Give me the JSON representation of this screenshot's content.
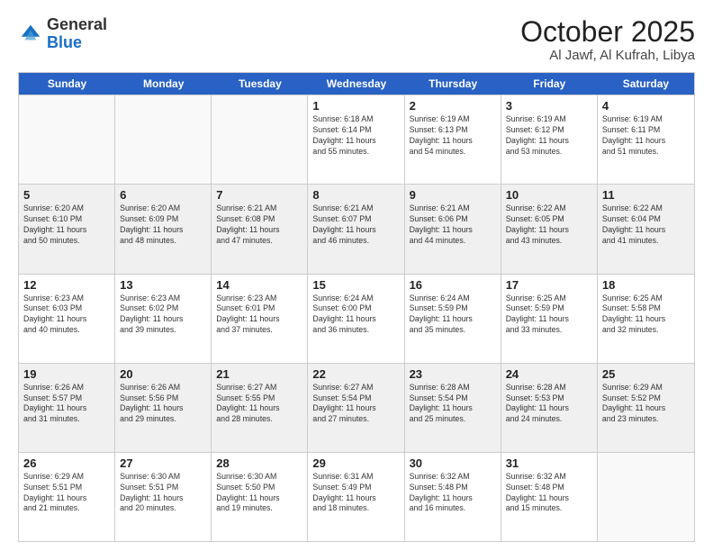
{
  "logo": {
    "general": "General",
    "blue": "Blue"
  },
  "header": {
    "month": "October 2025",
    "location": "Al Jawf, Al Kufrah, Libya"
  },
  "days": [
    "Sunday",
    "Monday",
    "Tuesday",
    "Wednesday",
    "Thursday",
    "Friday",
    "Saturday"
  ],
  "weeks": [
    [
      {
        "day": "",
        "info": "",
        "empty": true
      },
      {
        "day": "",
        "info": "",
        "empty": true
      },
      {
        "day": "",
        "info": "",
        "empty": true
      },
      {
        "day": "1",
        "info": "Sunrise: 6:18 AM\nSunset: 6:14 PM\nDaylight: 11 hours\nand 55 minutes."
      },
      {
        "day": "2",
        "info": "Sunrise: 6:19 AM\nSunset: 6:13 PM\nDaylight: 11 hours\nand 54 minutes."
      },
      {
        "day": "3",
        "info": "Sunrise: 6:19 AM\nSunset: 6:12 PM\nDaylight: 11 hours\nand 53 minutes."
      },
      {
        "day": "4",
        "info": "Sunrise: 6:19 AM\nSunset: 6:11 PM\nDaylight: 11 hours\nand 51 minutes."
      }
    ],
    [
      {
        "day": "5",
        "info": "Sunrise: 6:20 AM\nSunset: 6:10 PM\nDaylight: 11 hours\nand 50 minutes.",
        "shaded": true
      },
      {
        "day": "6",
        "info": "Sunrise: 6:20 AM\nSunset: 6:09 PM\nDaylight: 11 hours\nand 48 minutes.",
        "shaded": true
      },
      {
        "day": "7",
        "info": "Sunrise: 6:21 AM\nSunset: 6:08 PM\nDaylight: 11 hours\nand 47 minutes.",
        "shaded": true
      },
      {
        "day": "8",
        "info": "Sunrise: 6:21 AM\nSunset: 6:07 PM\nDaylight: 11 hours\nand 46 minutes.",
        "shaded": true
      },
      {
        "day": "9",
        "info": "Sunrise: 6:21 AM\nSunset: 6:06 PM\nDaylight: 11 hours\nand 44 minutes.",
        "shaded": true
      },
      {
        "day": "10",
        "info": "Sunrise: 6:22 AM\nSunset: 6:05 PM\nDaylight: 11 hours\nand 43 minutes.",
        "shaded": true
      },
      {
        "day": "11",
        "info": "Sunrise: 6:22 AM\nSunset: 6:04 PM\nDaylight: 11 hours\nand 41 minutes.",
        "shaded": true
      }
    ],
    [
      {
        "day": "12",
        "info": "Sunrise: 6:23 AM\nSunset: 6:03 PM\nDaylight: 11 hours\nand 40 minutes."
      },
      {
        "day": "13",
        "info": "Sunrise: 6:23 AM\nSunset: 6:02 PM\nDaylight: 11 hours\nand 39 minutes."
      },
      {
        "day": "14",
        "info": "Sunrise: 6:23 AM\nSunset: 6:01 PM\nDaylight: 11 hours\nand 37 minutes."
      },
      {
        "day": "15",
        "info": "Sunrise: 6:24 AM\nSunset: 6:00 PM\nDaylight: 11 hours\nand 36 minutes."
      },
      {
        "day": "16",
        "info": "Sunrise: 6:24 AM\nSunset: 5:59 PM\nDaylight: 11 hours\nand 35 minutes."
      },
      {
        "day": "17",
        "info": "Sunrise: 6:25 AM\nSunset: 5:59 PM\nDaylight: 11 hours\nand 33 minutes."
      },
      {
        "day": "18",
        "info": "Sunrise: 6:25 AM\nSunset: 5:58 PM\nDaylight: 11 hours\nand 32 minutes."
      }
    ],
    [
      {
        "day": "19",
        "info": "Sunrise: 6:26 AM\nSunset: 5:57 PM\nDaylight: 11 hours\nand 31 minutes.",
        "shaded": true
      },
      {
        "day": "20",
        "info": "Sunrise: 6:26 AM\nSunset: 5:56 PM\nDaylight: 11 hours\nand 29 minutes.",
        "shaded": true
      },
      {
        "day": "21",
        "info": "Sunrise: 6:27 AM\nSunset: 5:55 PM\nDaylight: 11 hours\nand 28 minutes.",
        "shaded": true
      },
      {
        "day": "22",
        "info": "Sunrise: 6:27 AM\nSunset: 5:54 PM\nDaylight: 11 hours\nand 27 minutes.",
        "shaded": true
      },
      {
        "day": "23",
        "info": "Sunrise: 6:28 AM\nSunset: 5:54 PM\nDaylight: 11 hours\nand 25 minutes.",
        "shaded": true
      },
      {
        "day": "24",
        "info": "Sunrise: 6:28 AM\nSunset: 5:53 PM\nDaylight: 11 hours\nand 24 minutes.",
        "shaded": true
      },
      {
        "day": "25",
        "info": "Sunrise: 6:29 AM\nSunset: 5:52 PM\nDaylight: 11 hours\nand 23 minutes.",
        "shaded": true
      }
    ],
    [
      {
        "day": "26",
        "info": "Sunrise: 6:29 AM\nSunset: 5:51 PM\nDaylight: 11 hours\nand 21 minutes."
      },
      {
        "day": "27",
        "info": "Sunrise: 6:30 AM\nSunset: 5:51 PM\nDaylight: 11 hours\nand 20 minutes."
      },
      {
        "day": "28",
        "info": "Sunrise: 6:30 AM\nSunset: 5:50 PM\nDaylight: 11 hours\nand 19 minutes."
      },
      {
        "day": "29",
        "info": "Sunrise: 6:31 AM\nSunset: 5:49 PM\nDaylight: 11 hours\nand 18 minutes."
      },
      {
        "day": "30",
        "info": "Sunrise: 6:32 AM\nSunset: 5:48 PM\nDaylight: 11 hours\nand 16 minutes."
      },
      {
        "day": "31",
        "info": "Sunrise: 6:32 AM\nSunset: 5:48 PM\nDaylight: 11 hours\nand 15 minutes."
      },
      {
        "day": "",
        "info": "",
        "empty": true
      }
    ]
  ]
}
